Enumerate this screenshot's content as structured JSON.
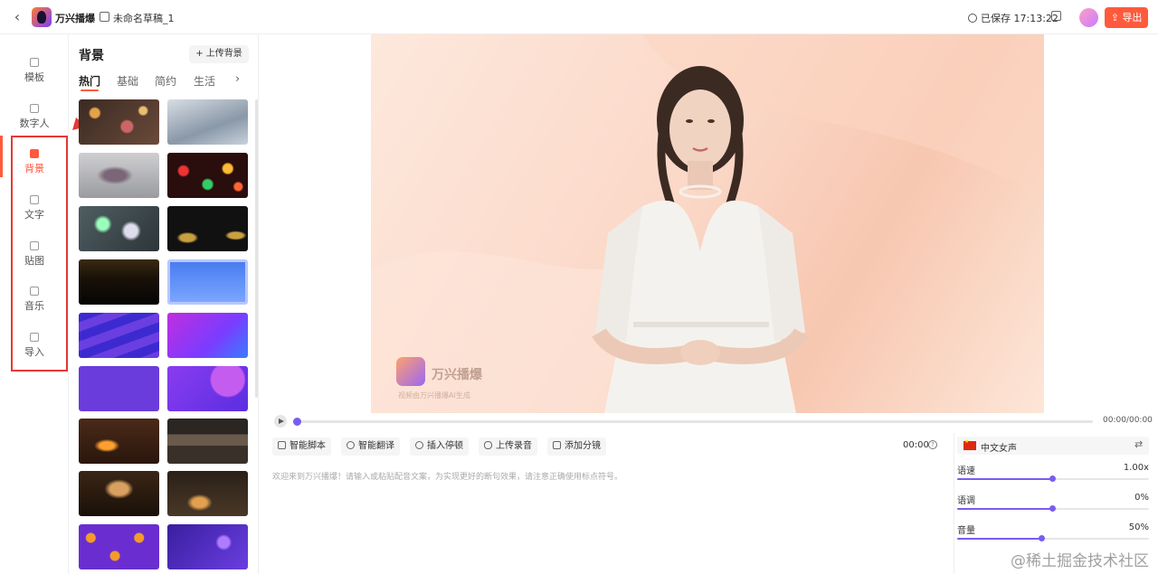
{
  "header": {
    "app_name": "万兴播爆",
    "doc_name": "未命名草稿_1",
    "saved_status": "已保存 17:13:22",
    "export_label": "导出"
  },
  "left_nav": {
    "items": [
      {
        "label": "模板",
        "active": false
      },
      {
        "label": "数字人",
        "active": false
      },
      {
        "label": "背景",
        "active": true
      },
      {
        "label": "文字",
        "active": false
      },
      {
        "label": "贴图",
        "active": false
      },
      {
        "label": "音乐",
        "active": false
      },
      {
        "label": "导入",
        "active": false
      }
    ],
    "accent": "#ff5a3c",
    "annotation_color": "#e53935"
  },
  "panel": {
    "title": "背景",
    "upload_label": "+ 上传背景",
    "tabs": [
      "热门",
      "基础",
      "简约",
      "生活"
    ],
    "active_tab": "热门",
    "thumbnails": [
      "bokeh-warm",
      "snow-trees",
      "frost-branch",
      "bokeh-red",
      "bokeh-blue",
      "christmas-tree",
      "gold-lights",
      "blue-frame",
      "new-arrivals",
      "purple-gradient",
      "purple-flat",
      "purple-bubbles",
      "fireplace",
      "kitchen",
      "dinner-table",
      "table-candles",
      "pumpkins",
      "purple-space"
    ]
  },
  "player": {
    "current_time": "00:00/00:00",
    "progress": 0,
    "watermark": "万兴播爆",
    "watermark_sub": "视频由万兴播爆AI生成"
  },
  "script_toolbar": {
    "buttons": [
      "智能脚本",
      "智能翻译",
      "插入停顿",
      "上传录音",
      "添加分镜"
    ],
    "duration": "00:00",
    "placeholder": "欢迎来到万兴播爆！请输入或粘贴配音文案，为实现更好的断句效果，请注意正确使用标点符号。"
  },
  "voice": {
    "name": "中文女声",
    "params": [
      {
        "label": "语速",
        "value": "1.00x",
        "level": 0.5
      },
      {
        "label": "语调",
        "value": "0%",
        "level": 0.5
      },
      {
        "label": "音量",
        "value": "50%",
        "level": 0.44
      }
    ],
    "slider_color": "#7a5cf0"
  },
  "watermark_site": "@稀土掘金技术社区"
}
